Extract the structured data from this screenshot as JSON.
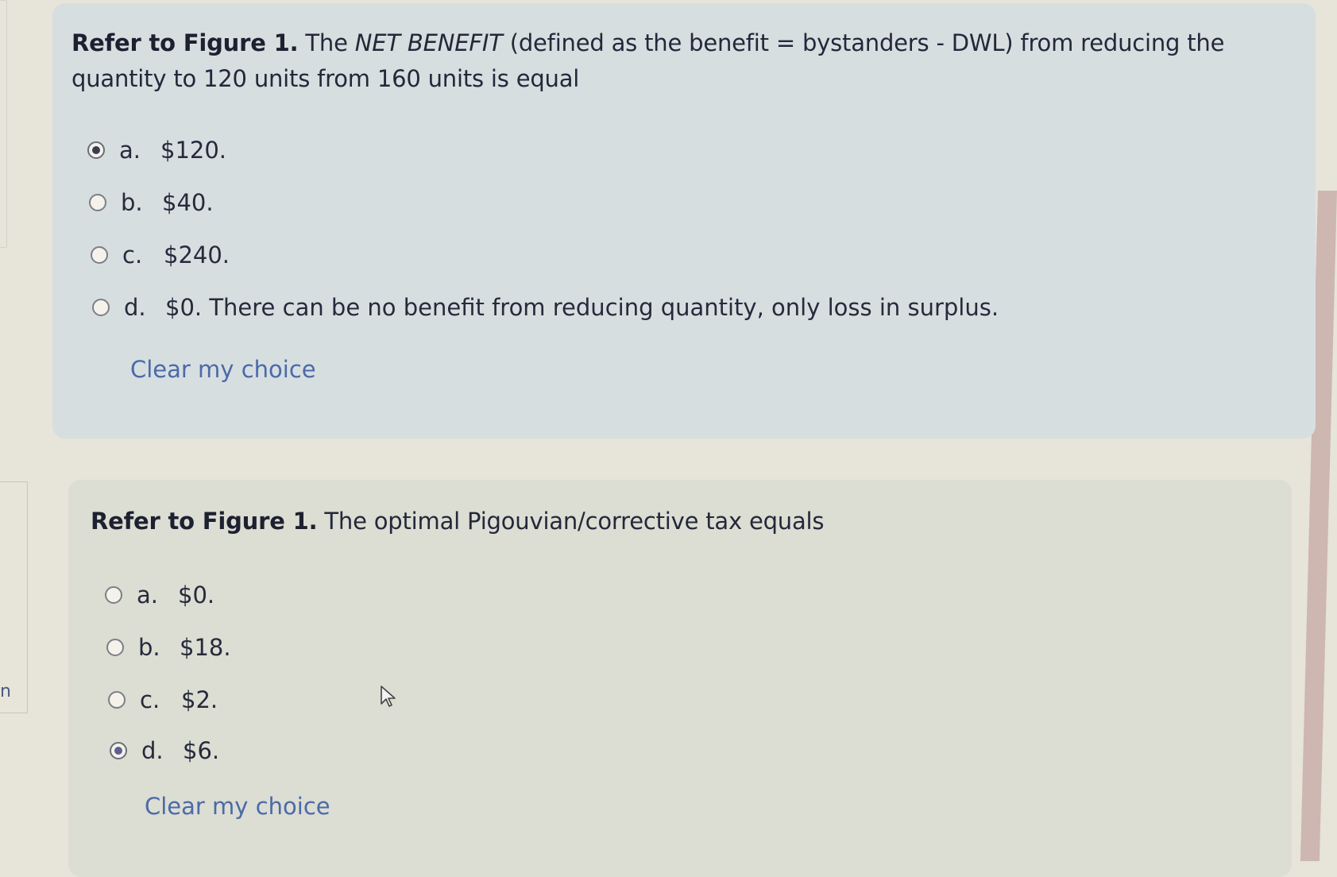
{
  "question1": {
    "prompt_bold": "Refer to Figure 1.",
    "prompt_pre": " The ",
    "prompt_italic": "NET BENEFIT",
    "prompt_post": " (defined as the benefit = bystanders - DWL) from reducing the quantity to 120 units from 160 units is equal",
    "options": [
      {
        "letter": "a.",
        "label": "$120.",
        "checked": true
      },
      {
        "letter": "b.",
        "label": "$40.",
        "checked": false
      },
      {
        "letter": "c.",
        "label": "$240.",
        "checked": false
      },
      {
        "letter": "d.",
        "label": "$0. There can be no benefit from reducing quantity, only loss in surplus.",
        "checked": false
      }
    ],
    "clear_label": "Clear my choice"
  },
  "question2": {
    "prompt_bold": "Refer to Figure 1.",
    "prompt_post": " The optimal Pigouvian/corrective tax equals",
    "options": [
      {
        "letter": "a.",
        "label": "$0.",
        "checked": false
      },
      {
        "letter": "b.",
        "label": "$18.",
        "checked": false
      },
      {
        "letter": "c.",
        "label": "$2.",
        "checked": false
      },
      {
        "letter": "d.",
        "label": "$6.",
        "checked": true
      }
    ],
    "clear_label": "Clear my choice"
  },
  "left_panel": {
    "partial_text": "n"
  },
  "colors": {
    "link": "#4a6aa8",
    "question1_bg": "#d7dee0",
    "question2_bg": "#dcddd3",
    "page_bg": "#e7e4da"
  }
}
